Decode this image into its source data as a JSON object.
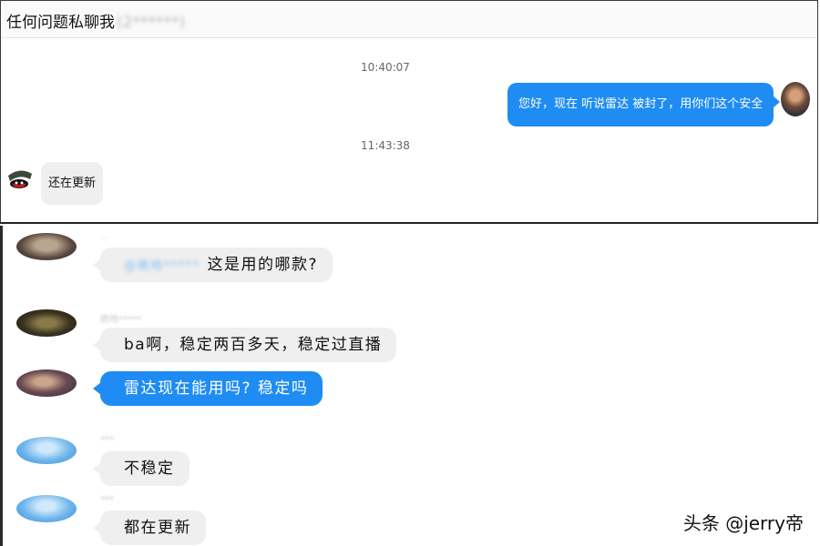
{
  "top_window": {
    "title": "任何问题私聊我",
    "title_hidden_suffix": "(2******)",
    "messages": [
      {
        "timestamp": "10:40:07",
        "direction": "outgoing",
        "text": "您好，现在 听说雷达 被封了，用你们这个安全吗?"
      },
      {
        "timestamp": "11:43:38",
        "direction": "incoming",
        "text": "还在更新"
      }
    ]
  },
  "group_chat": {
    "messages": [
      {
        "name": "...",
        "mention": "@绝地*****",
        "text": "这是用的哪款?",
        "style": "gray"
      },
      {
        "name": "绝地*****",
        "text": "ba啊，稳定两百多天，稳定过直播",
        "style": "gray"
      },
      {
        "name": "",
        "text": "雷达现在能用吗? 稳定吗",
        "style": "blue"
      },
      {
        "name": "***",
        "text": "不稳定",
        "style": "gray"
      },
      {
        "name": "***",
        "text": "都在更新",
        "style": "gray"
      }
    ]
  },
  "watermark": "头条 @jerry帝",
  "colors": {
    "accent_blue": "#1e8cf3",
    "bubble_gray": "#efefef"
  }
}
